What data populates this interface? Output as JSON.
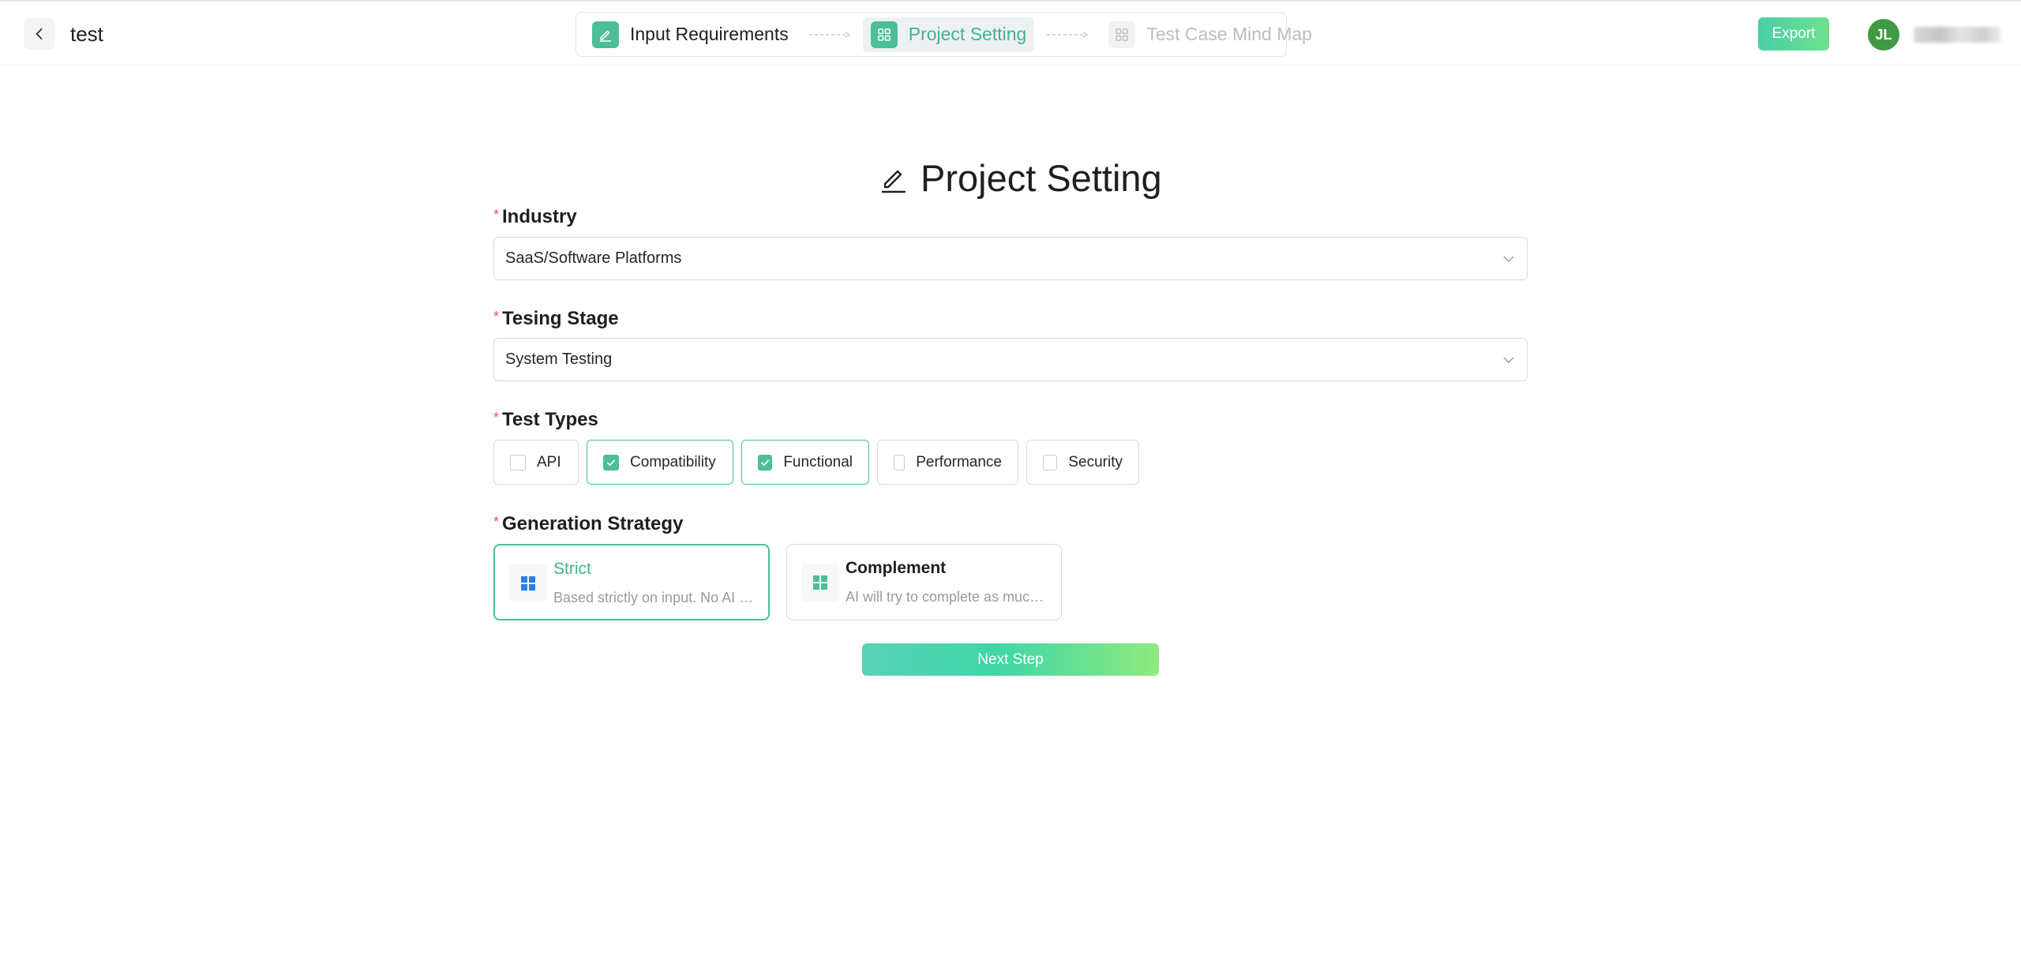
{
  "header": {
    "project_title": "test",
    "steps": [
      {
        "label": "Input Requirements",
        "state": "done",
        "icon": "edit-icon"
      },
      {
        "label": "Project Setting",
        "state": "current",
        "icon": "grid-icon"
      },
      {
        "label": "Test Case Mind Map",
        "state": "todo",
        "icon": "grid-icon"
      }
    ],
    "export_label": "Export",
    "avatar_initials": "JL"
  },
  "form": {
    "heading": "Project Setting",
    "industry": {
      "label": "Industry",
      "value": "SaaS/Software Platforms"
    },
    "testing_stage": {
      "label": "Tesing Stage",
      "value": "System Testing"
    },
    "test_types": {
      "label": "Test Types",
      "options": [
        {
          "label": "API",
          "checked": false
        },
        {
          "label": "Compatibility",
          "checked": true
        },
        {
          "label": "Functional",
          "checked": true
        },
        {
          "label": "Performance",
          "checked": false
        },
        {
          "label": "Security",
          "checked": false
        }
      ]
    },
    "generation_strategy": {
      "label": "Generation Strategy",
      "options": [
        {
          "title": "Strict",
          "description": "Based strictly on input. No AI s...",
          "selected": true
        },
        {
          "title": "Complement",
          "description": "AI will try to complete as much...",
          "selected": false
        }
      ]
    },
    "next_label": "Next Step"
  },
  "colors": {
    "accent": "#4cbf98",
    "accent_text": "#3fb58d",
    "required": "#ff4d4f",
    "avatar": "#3f9a46",
    "strict_icon": "#2f7fe0"
  }
}
